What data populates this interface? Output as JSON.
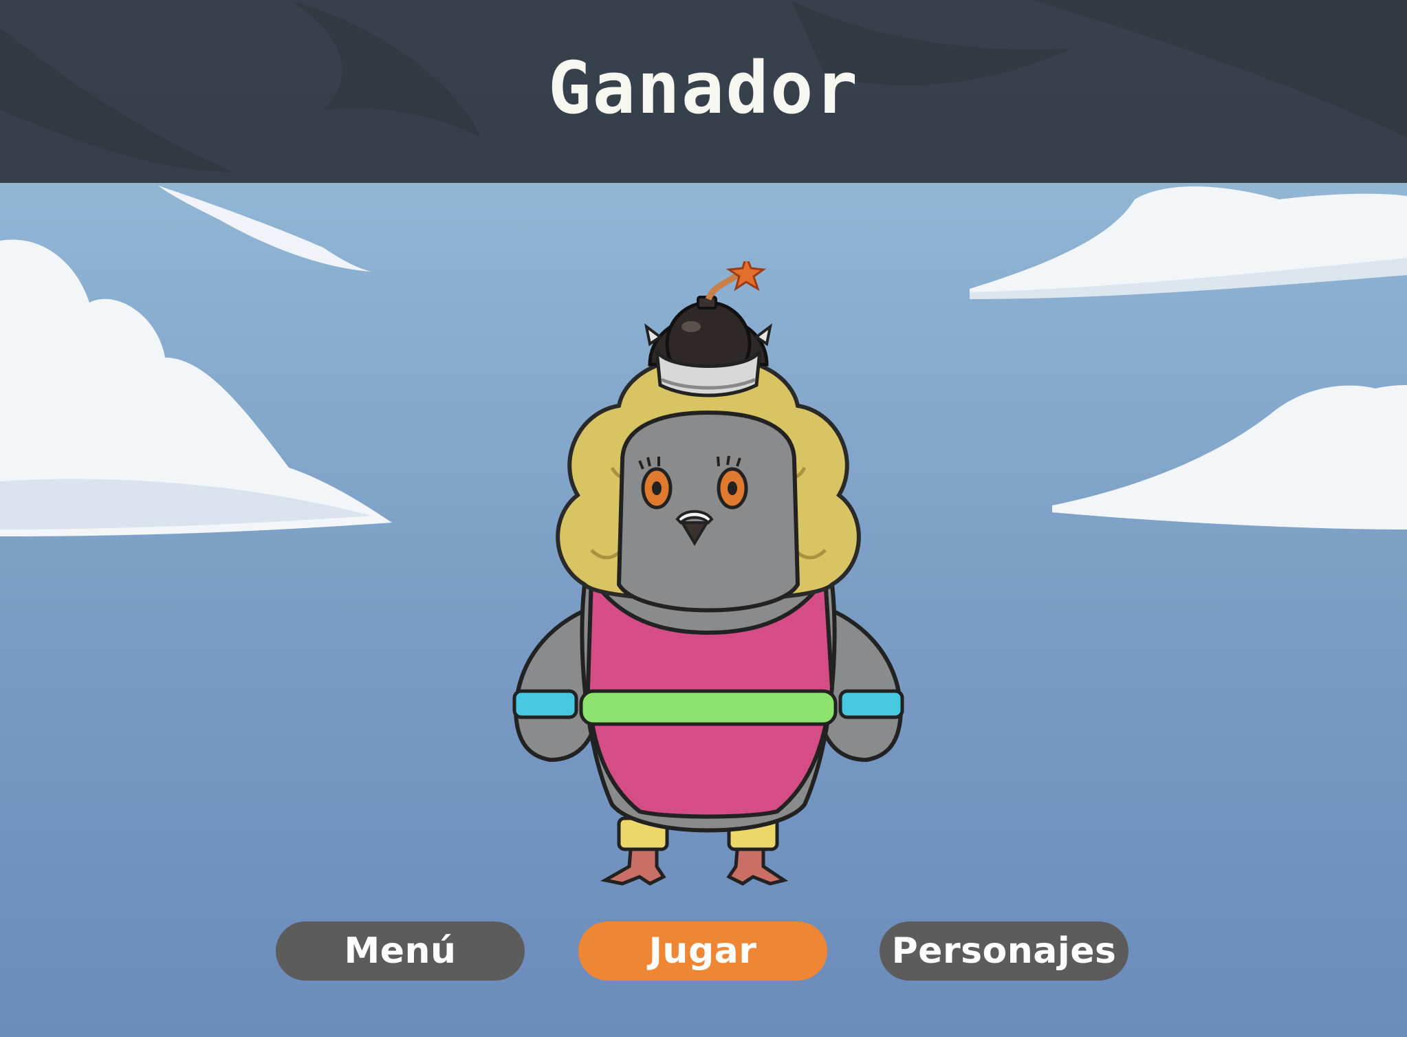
{
  "screen": {
    "title": "Ganador"
  },
  "buttons": {
    "menu_label": "Menú",
    "play_label": "Jugar",
    "characters_label": "Personajes"
  },
  "character": {
    "description_icon": "pigeon-character-icon",
    "accessory_icon": "bomb-crown-icon"
  },
  "colors": {
    "banner": "#262c34",
    "menu_button": "#5c5c5c",
    "play_button": "#ef8634",
    "characters_button": "#5c5c5c",
    "sky": "#8aaed0"
  }
}
